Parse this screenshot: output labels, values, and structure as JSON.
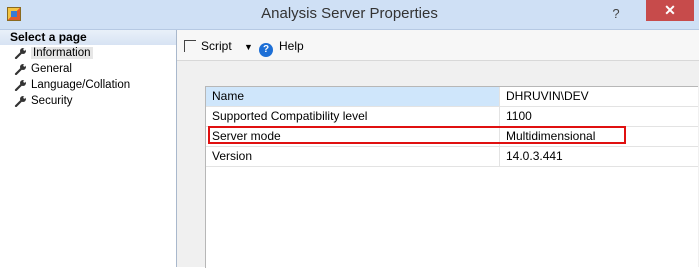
{
  "window": {
    "title": "Analysis Server Properties",
    "help_glyph": "?",
    "close_glyph": "✕"
  },
  "sidebar": {
    "header": "Select a page",
    "items": [
      {
        "label": "Information",
        "selected": true
      },
      {
        "label": "General",
        "selected": false
      },
      {
        "label": "Language/Collation",
        "selected": false
      },
      {
        "label": "Security",
        "selected": false
      }
    ]
  },
  "toolbar": {
    "script_label": "Script",
    "dropdown_glyph": "▼",
    "help_label": "Help",
    "help_icon_glyph": "?"
  },
  "properties": {
    "rows": [
      {
        "name": "Name",
        "value": "DHRUVIN\\DEV"
      },
      {
        "name": "Supported Compatibility level",
        "value": "1100"
      },
      {
        "name": "Server mode",
        "value": "Multidimensional"
      },
      {
        "name": "Version",
        "value": "14.0.3.441"
      }
    ]
  },
  "colors": {
    "highlight_border": "#e01010",
    "close_button": "#c74b4b",
    "title_bar": "#cfe0f5"
  }
}
